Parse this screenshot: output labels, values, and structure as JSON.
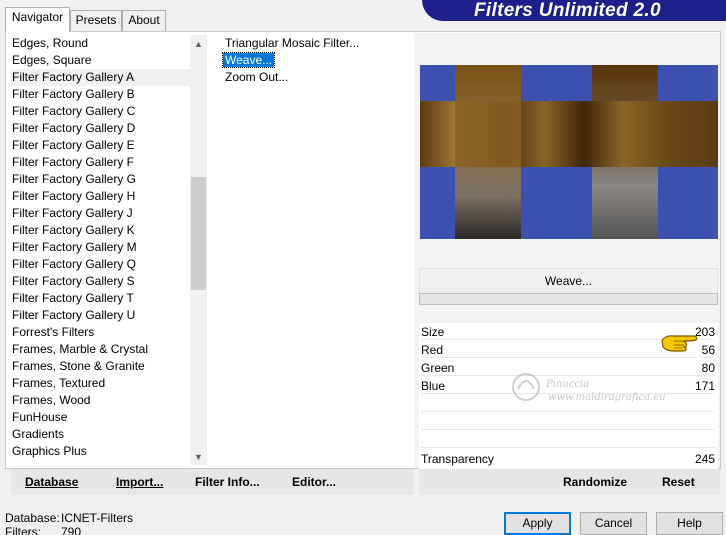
{
  "tabs": [
    {
      "label": "Navigator",
      "active": true
    },
    {
      "label": "Presets",
      "active": false
    },
    {
      "label": "About",
      "active": false
    }
  ],
  "banner": {
    "title": "Filters Unlimited 2.0"
  },
  "categories": [
    "Edges, Round",
    "Edges, Square",
    "Filter Factory Gallery A",
    "Filter Factory Gallery B",
    "Filter Factory Gallery C",
    "Filter Factory Gallery D",
    "Filter Factory Gallery E",
    "Filter Factory Gallery F",
    "Filter Factory Gallery G",
    "Filter Factory Gallery H",
    "Filter Factory Gallery J",
    "Filter Factory Gallery K",
    "Filter Factory Gallery M",
    "Filter Factory Gallery Q",
    "Filter Factory Gallery S",
    "Filter Factory Gallery T",
    "Filter Factory Gallery U",
    "Forrest's Filters",
    "Frames, Marble & Crystal",
    "Frames, Stone & Granite",
    "Frames, Textured",
    "Frames, Wood",
    "FunHouse",
    "Gradients",
    "Graphics Plus"
  ],
  "selected_category": "Filter Factory Gallery A",
  "filters": [
    {
      "label": "Triangular Mosaic Filter...",
      "selected": false
    },
    {
      "label": "Weave...",
      "selected": true
    },
    {
      "label": "Zoom Out...",
      "selected": false
    }
  ],
  "current_filter": "Weave...",
  "params": [
    {
      "label": "Size",
      "value": "203"
    },
    {
      "label": "Red",
      "value": "56"
    },
    {
      "label": "Green",
      "value": "80"
    },
    {
      "label": "Blue",
      "value": "171"
    },
    {
      "label": "Transparency",
      "value": "245"
    }
  ],
  "watermark": {
    "line1": "Pinuccia",
    "line2": "www.maldiragrafica.eu"
  },
  "toolbar_left": {
    "database": "Database",
    "import": "Import...",
    "filter_info": "Filter Info...",
    "editor": "Editor..."
  },
  "toolbar_right": {
    "randomize": "Randomize",
    "reset": "Reset"
  },
  "status": {
    "database_label": "Database:",
    "database_value": "ICNET-Filters",
    "filters_label": "Filters:",
    "filters_value": "790"
  },
  "buttons": {
    "apply": "Apply",
    "cancel": "Cancel",
    "help": "Help"
  },
  "colors": {
    "banner": "#1b1f8a",
    "selection": "#0078d7",
    "weave_blue": "#3a50b0",
    "weave_brown": "#7a5520"
  }
}
